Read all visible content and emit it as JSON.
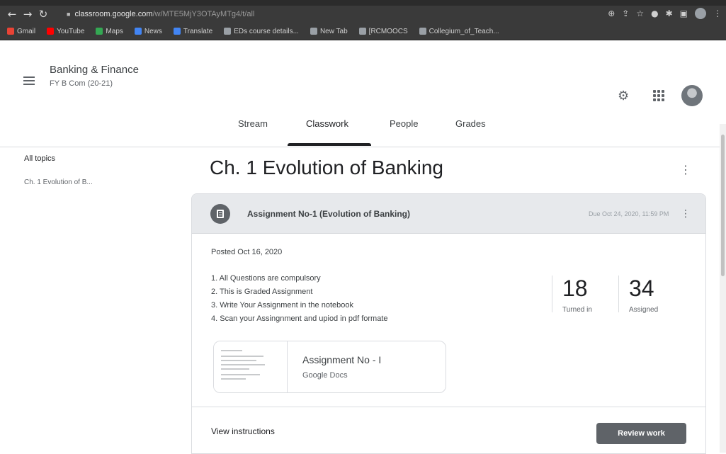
{
  "browser": {
    "url_host": "classroom.google.com",
    "url_path": "/w/MTE5MjY3OTAyMTg4/t/all",
    "bookmarks": [
      {
        "label": "Gmail",
        "icon": "gmail-icon",
        "color": "#ea4335"
      },
      {
        "label": "YouTube",
        "icon": "youtube-icon",
        "color": "#ff0000"
      },
      {
        "label": "Maps",
        "icon": "maps-icon",
        "color": "#34a853"
      },
      {
        "label": "News",
        "icon": "news-icon",
        "color": "#4285f4"
      },
      {
        "label": "Translate",
        "icon": "translate-icon",
        "color": "#4285f4"
      },
      {
        "label": "EDs course details...",
        "icon": "bookmark-icon",
        "color": "#9aa0a6"
      },
      {
        "label": "New Tab",
        "icon": "new-tab-icon",
        "color": "#9aa0a6"
      },
      {
        "label": "[RCMOOCS",
        "icon": "bookmark-icon",
        "color": "#9aa0a6"
      },
      {
        "label": "Collegium_of_Teach...",
        "icon": "bookmark-icon",
        "color": "#9aa0a6"
      }
    ]
  },
  "header": {
    "class_name": "Banking & Finance",
    "class_section": "FY B Com (20-21)"
  },
  "tabs": [
    {
      "label": "Stream",
      "active": false
    },
    {
      "label": "Classwork",
      "active": true
    },
    {
      "label": "People",
      "active": false
    },
    {
      "label": "Grades",
      "active": false
    }
  ],
  "sidebar": {
    "title": "All topics",
    "items": [
      {
        "label": "Ch. 1 Evolution of B..."
      }
    ]
  },
  "topic": {
    "title": "Ch. 1 Evolution of Banking"
  },
  "assignment": {
    "title": "Assignment No-1 (Evolution of Banking)",
    "due": "Due Oct 24, 2020, 11:59 PM",
    "posted": "Posted Oct 16, 2020",
    "instructions": [
      "1. All Questions are compulsory",
      "2. This is Graded Assignment",
      "3. Write Your Assignment in the notebook",
      "4. Scan your Assingnment and upiod in pdf formate"
    ],
    "turned_in_count": "18",
    "turned_in_label": "Turned in",
    "assigned_count": "34",
    "assigned_label": "Assigned",
    "attachment_title": "Assignment No - I",
    "attachment_type": "Google Docs",
    "view_instructions_label": "View instructions",
    "review_work_label": "Review work"
  }
}
